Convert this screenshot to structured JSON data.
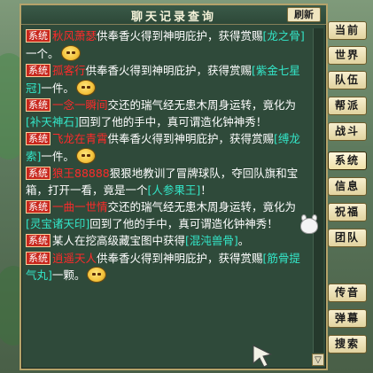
{
  "window": {
    "title": "聊天记录查询",
    "refresh_label": "刷新",
    "scroll_down_label": "▽"
  },
  "side_tabs": [
    "当前",
    "世界",
    "队伍",
    "帮派",
    "战斗",
    "系统",
    "信息",
    "祝福",
    "团队",
    "传音",
    "弹幕",
    "搜索"
  ],
  "messages": [
    {
      "tag": "系统",
      "parts": [
        {
          "t": "name",
          "v": "秋风萧瑟"
        },
        {
          "t": "text",
          "v": "供奉香火得到神明庇护，获得赏赐"
        },
        {
          "t": "item",
          "v": "[龙之骨]"
        },
        {
          "t": "text",
          "v": "一个。"
        },
        {
          "t": "emote"
        }
      ]
    },
    {
      "tag": "系统",
      "parts": [
        {
          "t": "name",
          "v": "孤客行"
        },
        {
          "t": "text",
          "v": "供奉香火得到神明庇护，获得赏赐"
        },
        {
          "t": "item",
          "v": "[紫金七星冠]"
        },
        {
          "t": "text",
          "v": "一件。"
        },
        {
          "t": "emote"
        }
      ]
    },
    {
      "tag": "系统",
      "parts": [
        {
          "t": "name",
          "v": "一念一瞬间"
        },
        {
          "t": "text",
          "v": "交还的瑞气经无患木周身运转，竟化为"
        },
        {
          "t": "item",
          "v": "[补天神石]"
        },
        {
          "t": "text",
          "v": "回到了他的手中，真可谓造化钟神秀！"
        }
      ]
    },
    {
      "tag": "系统",
      "parts": [
        {
          "t": "name",
          "v": "飞龙在青霄"
        },
        {
          "t": "text",
          "v": "供奉香火得到神明庇护，获得赏赐"
        },
        {
          "t": "item",
          "v": "[缚龙索]"
        },
        {
          "t": "text",
          "v": "一件。"
        },
        {
          "t": "emote"
        }
      ]
    },
    {
      "tag": "系统",
      "parts": [
        {
          "t": "name",
          "v": "狼王88888"
        },
        {
          "t": "text",
          "v": "狠狠地教训了冒牌球队，夺回队旗和宝箱，打开一看，竟是一个"
        },
        {
          "t": "item",
          "v": "[人参果王]"
        },
        {
          "t": "text",
          "v": "！"
        }
      ]
    },
    {
      "tag": "系统",
      "parts": [
        {
          "t": "name",
          "v": "一曲一世情"
        },
        {
          "t": "text",
          "v": "交还的瑞气经无患木周身运转，竟化为"
        },
        {
          "t": "item",
          "v": "[灵宝诸天印]"
        },
        {
          "t": "text",
          "v": "回到了他的手中，真可谓造化钟神秀！"
        }
      ]
    },
    {
      "tag": "系统",
      "parts": [
        {
          "t": "text",
          "v": "某人在挖高级藏宝图中获得"
        },
        {
          "t": "item",
          "v": "[混沌兽骨]"
        },
        {
          "t": "text",
          "v": "。"
        }
      ]
    },
    {
      "tag": "系统",
      "parts": [
        {
          "t": "name",
          "v": "逍遥天人"
        },
        {
          "t": "text",
          "v": "供奉香火得到神明庇护，获得赏赐"
        },
        {
          "t": "item",
          "v": "[筋骨提气丸]"
        },
        {
          "t": "text",
          "v": "一颗。"
        },
        {
          "t": "emote"
        }
      ]
    }
  ],
  "colors": {
    "system_tag": "#c8281e",
    "player_name": "#ff2a2a",
    "item_link": "#33e6c8",
    "body_text": "#ffffff"
  }
}
